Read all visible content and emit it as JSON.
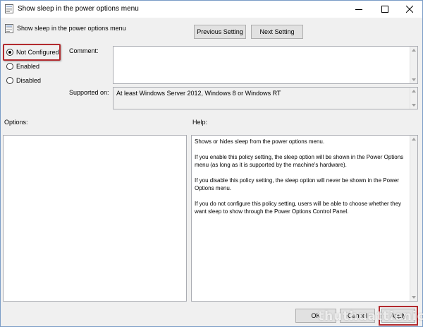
{
  "window": {
    "title": "Show sleep in the power options menu",
    "controls": {
      "minimize": "minimize",
      "maximize": "maximize",
      "close": "close"
    }
  },
  "header": {
    "title": "Show sleep in the power options menu",
    "prev_button": "Previous Setting",
    "next_button": "Next Setting"
  },
  "state": {
    "options": [
      {
        "label": "Not Configured",
        "checked": true
      },
      {
        "label": "Enabled",
        "checked": false
      },
      {
        "label": "Disabled",
        "checked": false
      }
    ]
  },
  "comment": {
    "label": "Comment:",
    "value": ""
  },
  "supported": {
    "label": "Supported on:",
    "value": "At least Windows Server 2012, Windows 8 or Windows RT"
  },
  "options_panel": {
    "label": "Options:"
  },
  "help": {
    "label": "Help:",
    "paragraphs": [
      "Shows or hides sleep from the power options menu.",
      "If you enable this policy setting, the sleep option will be shown in the Power Options menu (as long as it is supported by the machine's hardware).",
      "If you disable this policy setting, the sleep option will never be shown in the Power Options menu.",
      "If you do not configure this policy setting, users will be able to choose whether they want sleep to show through the Power Options Control Panel."
    ]
  },
  "footer": {
    "ok": "OK",
    "cancel": "Cancel",
    "apply": "Apply"
  },
  "watermark": "thuthuattienich",
  "colors": {
    "highlight": "#b22a2e",
    "window_bg": "#f0f0f0",
    "button_bg": "#e1e1e1"
  }
}
